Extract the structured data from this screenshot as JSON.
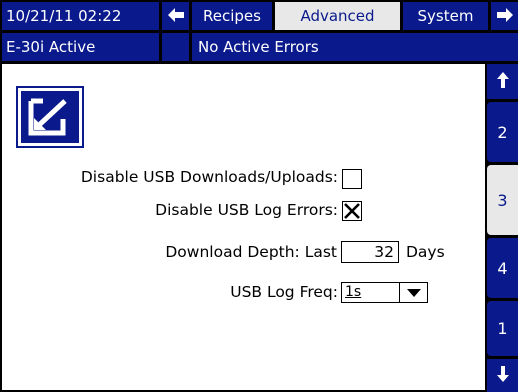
{
  "header": {
    "datetime": "10/21/11 02:22",
    "nav_left_icon": "arrow-left",
    "tabs": [
      {
        "label": "Recipes"
      },
      {
        "label": "Advanced"
      },
      {
        "label": "System"
      }
    ],
    "nav_right_icon": "arrow-right",
    "status_machine": "E-30i Active",
    "status_errors": "No Active Errors"
  },
  "main": {
    "mode_icon": "edit-arrow-icon",
    "settings": {
      "disable_usb_transfer_label": "Disable USB Downloads/Uploads:",
      "disable_usb_transfer_checked": false,
      "disable_usb_log_errors_label": "Disable USB Log Errors:",
      "disable_usb_log_errors_checked": true,
      "download_depth_label": "Download Depth: Last",
      "download_depth_value": "32",
      "download_depth_unit": "Days",
      "usb_log_freq_label": "USB Log Freq:",
      "usb_log_freq_value": "1s"
    }
  },
  "side_tabs": {
    "up_icon": "arrow-up",
    "pages": [
      "2",
      "3",
      "4",
      "1"
    ],
    "active_page": "3",
    "down_icon": "arrow-down"
  },
  "colors": {
    "primary": "#0a1a8c",
    "inactive_tab": "#e8e8e8",
    "background": "#ffffff"
  }
}
